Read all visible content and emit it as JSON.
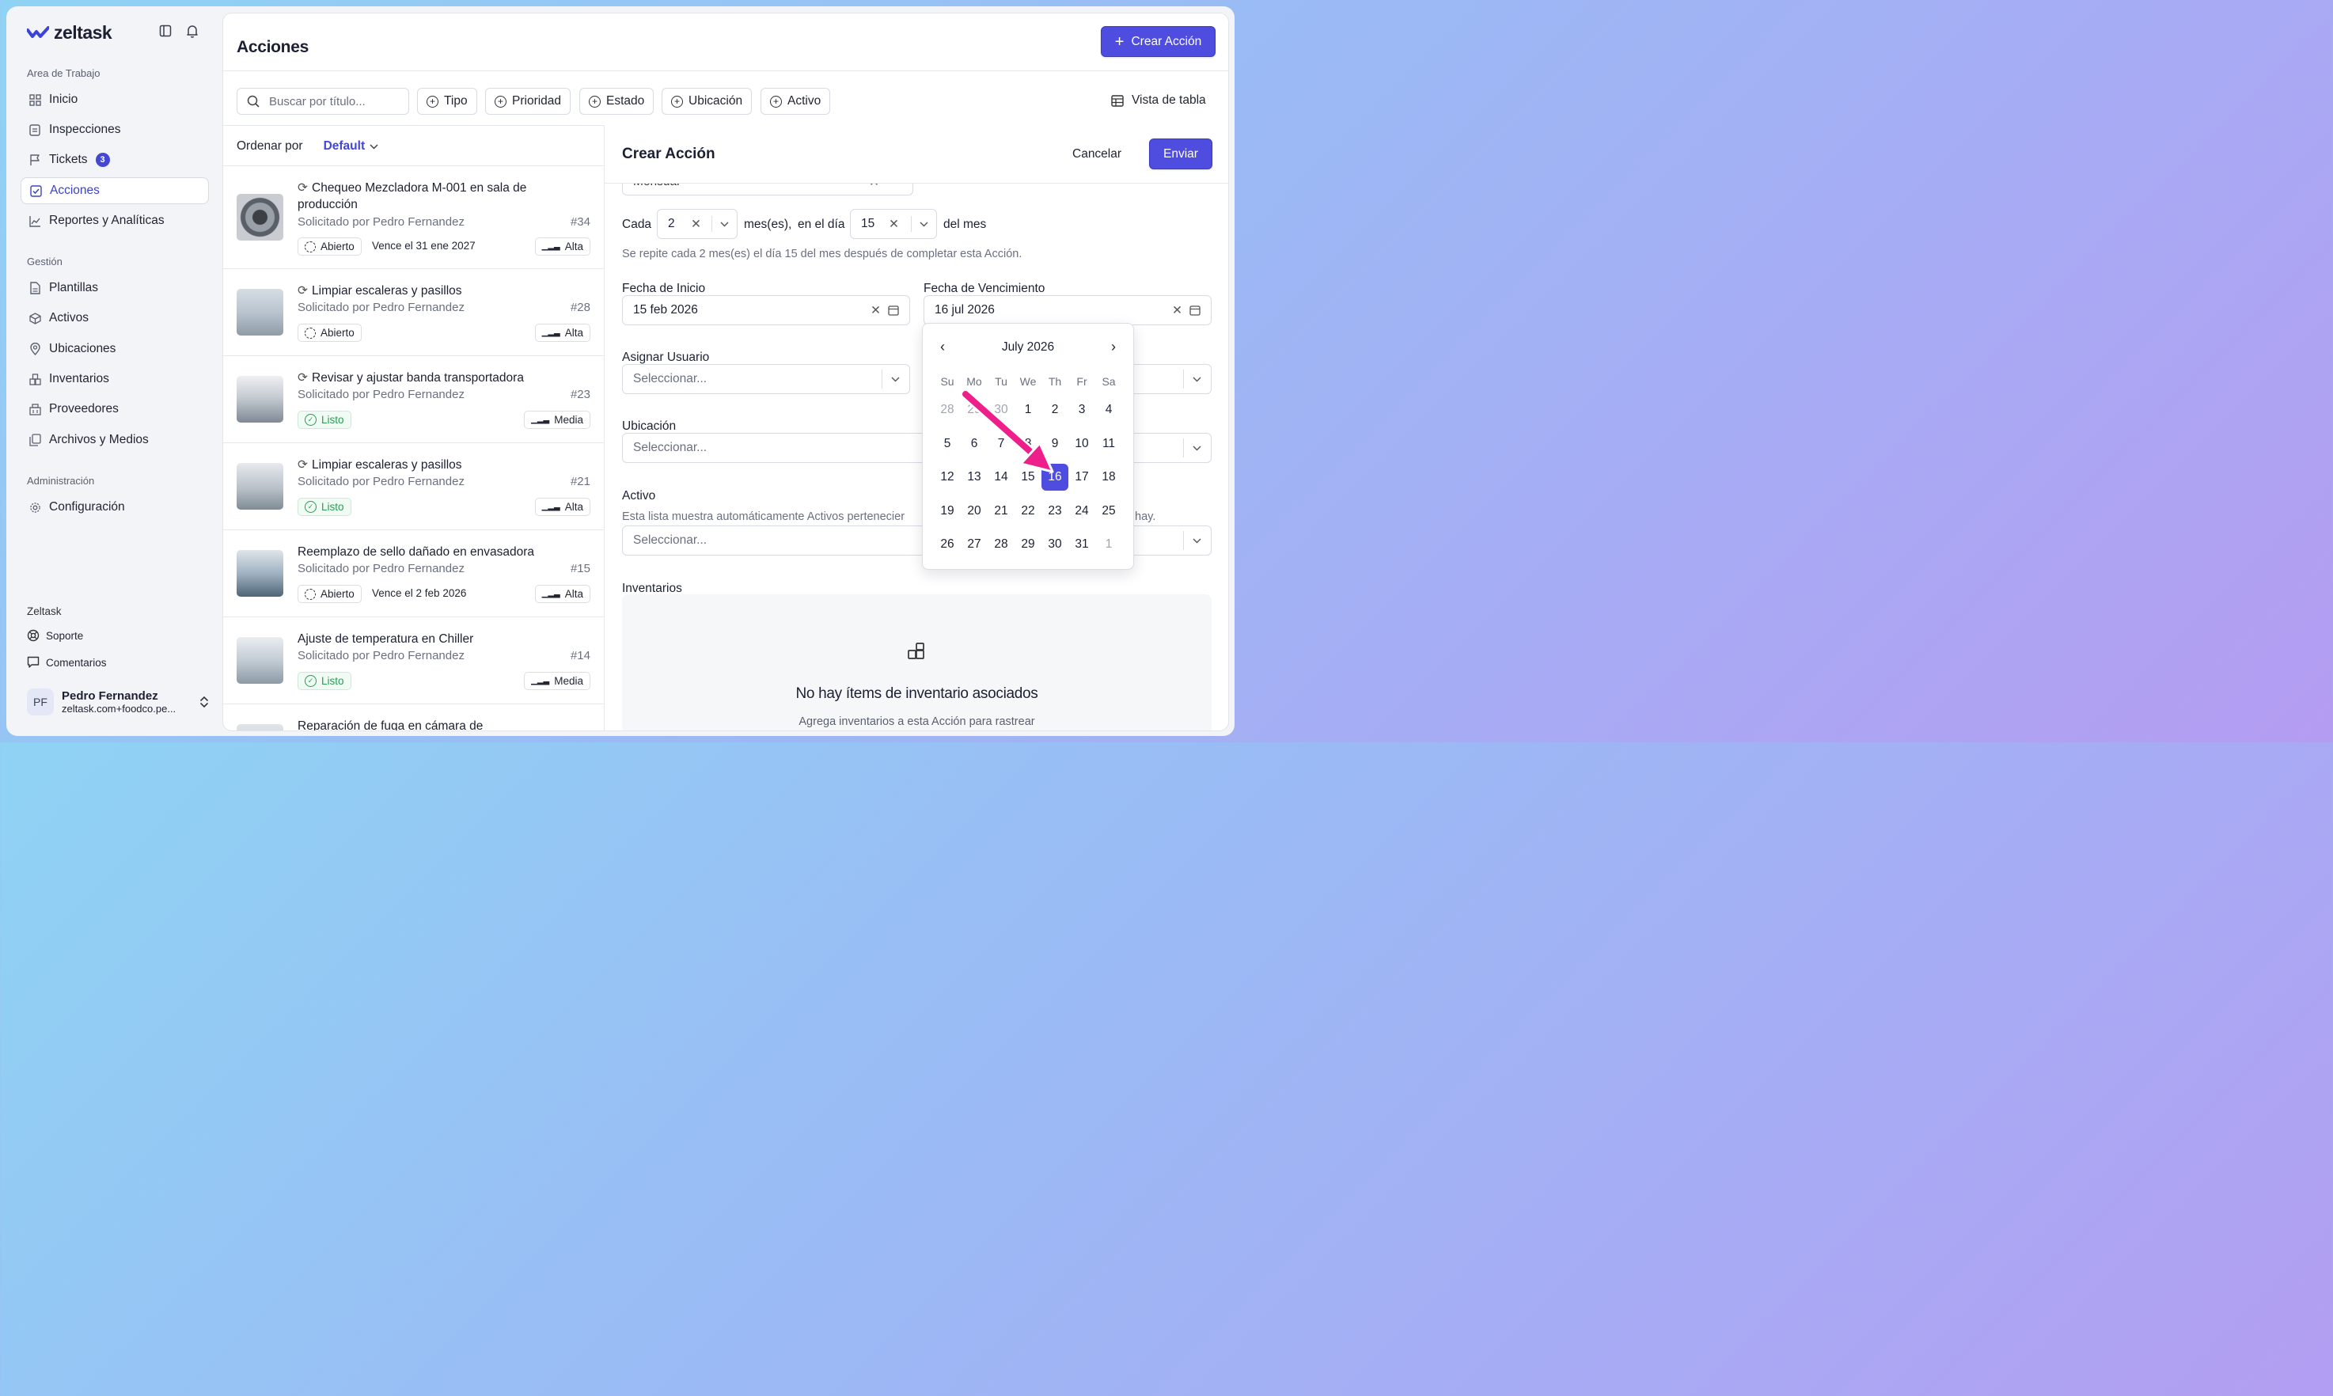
{
  "brand": {
    "name": "zeltask"
  },
  "sidebar": {
    "workspace_label": "Area de Trabajo",
    "workspace_items": [
      {
        "label": "Inicio",
        "icon": "grid-icon"
      },
      {
        "label": "Inspecciones",
        "icon": "clipboard-icon"
      },
      {
        "label": "Tickets",
        "icon": "flag-icon",
        "badge": "3"
      },
      {
        "label": "Acciones",
        "icon": "check-square-icon",
        "active": true
      },
      {
        "label": "Reportes y Analíticas",
        "icon": "chart-icon"
      }
    ],
    "management_label": "Gestión",
    "management_items": [
      {
        "label": "Plantillas",
        "icon": "document-icon"
      },
      {
        "label": "Activos",
        "icon": "cube-icon"
      },
      {
        "label": "Ubicaciones",
        "icon": "map-pin-icon"
      },
      {
        "label": "Inventarios",
        "icon": "boxes-icon"
      },
      {
        "label": "Proveedores",
        "icon": "building-icon"
      },
      {
        "label": "Archivos y Medios",
        "icon": "files-icon"
      }
    ],
    "admin_label": "Administración",
    "admin_items": [
      {
        "label": "Configuración",
        "icon": "gear-icon"
      }
    ],
    "footer_label": "Zeltask",
    "footer_items": [
      {
        "label": "Soporte",
        "icon": "lifebuoy-icon"
      },
      {
        "label": "Comentarios",
        "icon": "message-icon"
      }
    ],
    "user": {
      "initials": "PF",
      "name": "Pedro Fernandez",
      "email": "zeltask.com+foodco.pe..."
    }
  },
  "header": {
    "title": "Acciones",
    "create_label": "Crear Acción",
    "search_placeholder": "Buscar por título...",
    "filters": [
      "Tipo",
      "Prioridad",
      "Estado",
      "Ubicación",
      "Activo"
    ],
    "view_label": "Vista de tabla"
  },
  "list": {
    "sort_label": "Ordenar por",
    "sort_value": "Default",
    "items": [
      {
        "title": "Chequeo Mezcladora M-001 en sala de producción",
        "recurring": true,
        "requested": "Solicitado por Pedro Fernandez",
        "num": "#34",
        "status": "Abierto",
        "due": "Vence el 31 ene 2027",
        "priority": "Alta"
      },
      {
        "title": "Limpiar escaleras y pasillos",
        "recurring": true,
        "requested": "Solicitado por Pedro Fernandez",
        "num": "#28",
        "status": "Abierto",
        "due": "",
        "priority": "Alta"
      },
      {
        "title": "Revisar y ajustar banda transportadora",
        "recurring": true,
        "requested": "Solicitado por Pedro Fernandez",
        "num": "#23",
        "status": "Listo",
        "due": "",
        "priority": "Media"
      },
      {
        "title": "Limpiar escaleras y pasillos",
        "recurring": true,
        "requested": "Solicitado por Pedro Fernandez",
        "num": "#21",
        "status": "Listo",
        "due": "",
        "priority": "Alta"
      },
      {
        "title": "Reemplazo de sello dañado en envasadora",
        "recurring": false,
        "requested": "Solicitado por Pedro Fernandez",
        "num": "#15",
        "status": "Abierto",
        "due": "Vence el 2 feb 2026",
        "priority": "Alta"
      },
      {
        "title": "Ajuste de temperatura en Chiller",
        "recurring": false,
        "requested": "Solicitado por Pedro Fernandez",
        "num": "#14",
        "status": "Listo",
        "due": "",
        "priority": "Media"
      },
      {
        "title": "Reparación de fuga en cámara de refrigeración",
        "recurring": false,
        "requested": "",
        "num": "",
        "status": "",
        "due": "",
        "priority": ""
      }
    ]
  },
  "form": {
    "title": "Crear Acción",
    "cancel_label": "Cancelar",
    "submit_label": "Enviar",
    "frequency_value": "Mensual",
    "every_label": "Cada",
    "every_value": "2",
    "months_label": "mes(es),",
    "on_day_label": "en el día",
    "day_value": "15",
    "of_month_label": "del mes",
    "repeat_help": "Se repite cada 2 mes(es) el día 15 del mes después de completar esta Acción.",
    "start_label": "Fecha de Inicio",
    "start_value": "15 feb 2026",
    "due_label": "Fecha de Vencimiento",
    "due_value": "16 jul 2026",
    "assign_label": "Asignar Usuario",
    "assign_placeholder": "Seleccionar...",
    "location_label": "Ubicación",
    "location_placeholder": "Seleccionar...",
    "asset_label": "Activo",
    "asset_help_left": "Esta lista muestra automáticamente Activos pertenecier",
    "asset_help_right": "hay.",
    "asset_placeholder": "Seleccionar...",
    "inventory_label": "Inventarios",
    "inventory_empty_title": "No hay ítems de inventario asociados",
    "inventory_empty_sub": "Agrega inventarios a esta Acción para rastrear"
  },
  "calendar": {
    "month": "July 2026",
    "weekdays": [
      "Su",
      "Mo",
      "Tu",
      "We",
      "Th",
      "Fr",
      "Sa"
    ],
    "weeks": [
      [
        "28",
        "29",
        "30",
        "1",
        "2",
        "3",
        "4"
      ],
      [
        "5",
        "6",
        "7",
        "8",
        "9",
        "10",
        "11"
      ],
      [
        "12",
        "13",
        "14",
        "15",
        "16",
        "17",
        "18"
      ],
      [
        "19",
        "20",
        "21",
        "22",
        "23",
        "24",
        "25"
      ],
      [
        "26",
        "27",
        "28",
        "29",
        "30",
        "31",
        "1"
      ]
    ],
    "selected": "16"
  },
  "colors": {
    "accent": "#4f4ce0",
    "arrow": "#ee1f8a",
    "success": "#2d9a56"
  }
}
